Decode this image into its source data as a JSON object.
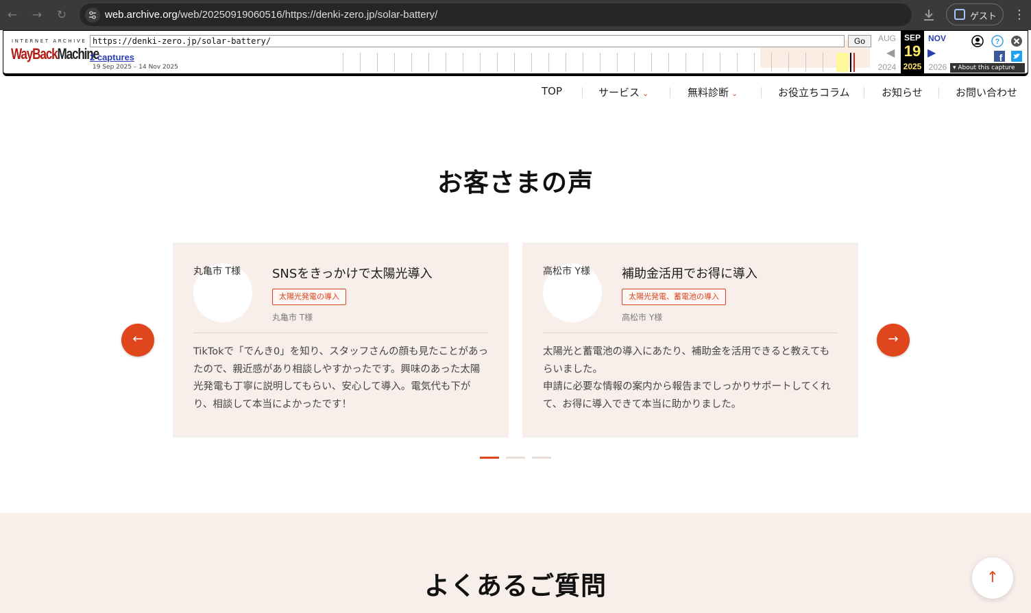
{
  "browser": {
    "url_host": "web.archive.org",
    "url_path": "/web/20250919060516/https://denki-zero.jp/solar-battery/",
    "profile_label": "ゲスト",
    "back_icon": "back-arrow-icon",
    "forward_icon": "forward-arrow-icon",
    "reload_icon": "reload-icon"
  },
  "wayback": {
    "logo_top": "INTERNET ARCHIVE",
    "logo_way": "Way",
    "logo_back": "Back",
    "logo_machine": "Machine",
    "url_value": "https://denki-zero.jp/solar-battery/",
    "go_label": "Go",
    "captures_link": "2 captures",
    "date_range": "19 Sep 2025 – 14 Nov 2025",
    "prev_month": "AUG",
    "prev_year": "2024",
    "current_month": "SEP",
    "current_day": "19",
    "current_year": "2025",
    "next_month": "NOV",
    "next_year": "2026",
    "about_label": "About this capture"
  },
  "nav": {
    "items": [
      {
        "label": "TOP"
      },
      {
        "label": "サービス"
      },
      {
        "label": "無料診断"
      },
      {
        "label": "お役立ちコラム"
      },
      {
        "label": "お知らせ"
      },
      {
        "label": "お問い合わせ"
      }
    ]
  },
  "testimonials": {
    "title": "お客さまの声",
    "cards": [
      {
        "avatar_alt": "丸亀市 T様",
        "title": "SNSをきっかけで太陽光導入",
        "tag": "太陽光発電の導入",
        "customer": "丸亀市 T様",
        "body": "TikTokで「でんき0」を知り、スタッフさんの顔も見たことがあったので、親近感があり相談しやすかったです。興味のあった太陽光発電も丁寧に説明してもらい、安心して導入。電気代も下がり、相談して本当によかったです！"
      },
      {
        "avatar_alt": "高松市 Y様",
        "title": "補助金活用でお得に導入",
        "tag": "太陽光発電、蓄電池の導入",
        "customer": "高松市 Y様",
        "body_line1": "太陽光と蓄電池の導入にあたり、補助金を活用できると教えてもらいました。",
        "body_line2": "申請に必要な情報の案内から報告までしっかりサポートしてくれて、お得に導入できて本当に助かりました。"
      }
    ],
    "prev_icon": "arrow-left-icon",
    "next_icon": "arrow-right-icon",
    "active_page": 1,
    "page_count": 3
  },
  "faq": {
    "title": "よくあるご質問"
  },
  "colors": {
    "accent": "#e0461b",
    "card_bg": "#f8efeb"
  }
}
